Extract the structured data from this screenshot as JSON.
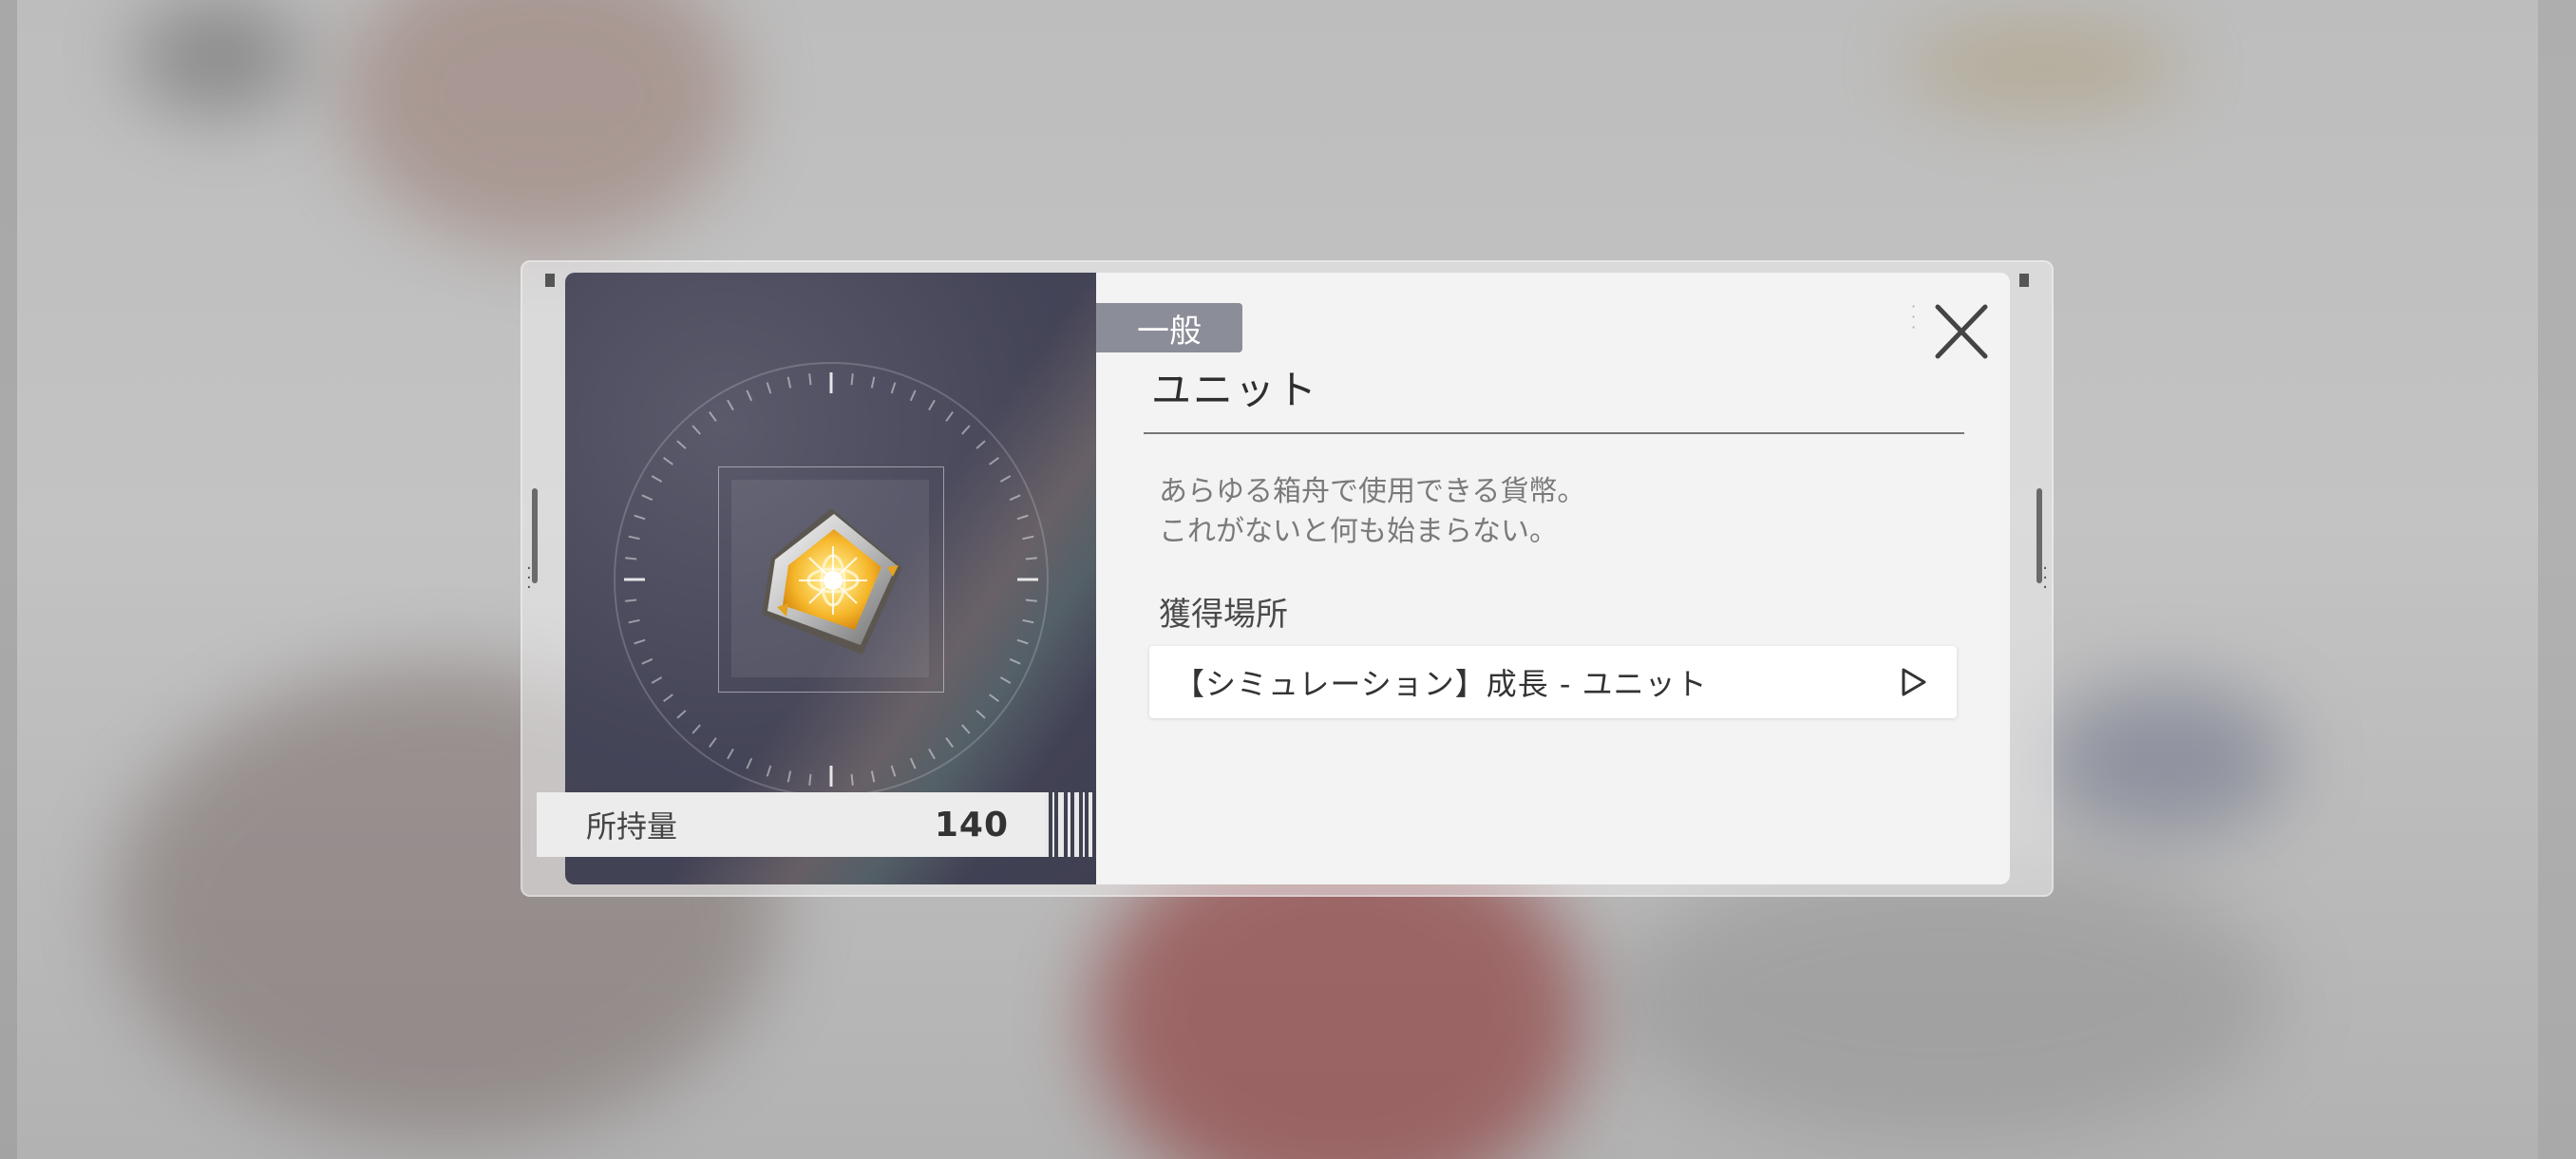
{
  "item": {
    "category": "一般",
    "name": "ユニット",
    "description_lines": [
      "あらゆる箱舟で使用できる貨幣。",
      "これがないと何も始まらない。"
    ],
    "owned_label": "所持量",
    "owned_count": "140",
    "icon": "gold-gem-currency-icon"
  },
  "acquisition": {
    "heading": "獲得場所",
    "sources": [
      {
        "label": "【シミュレーション】成長 - ユニット",
        "icon": "play-triangle-icon"
      }
    ]
  },
  "controls": {
    "close_icon": "close-x-icon"
  },
  "colors": {
    "category_tag": "#8b8d98",
    "panel_bg": "#f3f3f3",
    "icon_panel_bg": "#454558",
    "gem_gold": "#f5b62a"
  }
}
